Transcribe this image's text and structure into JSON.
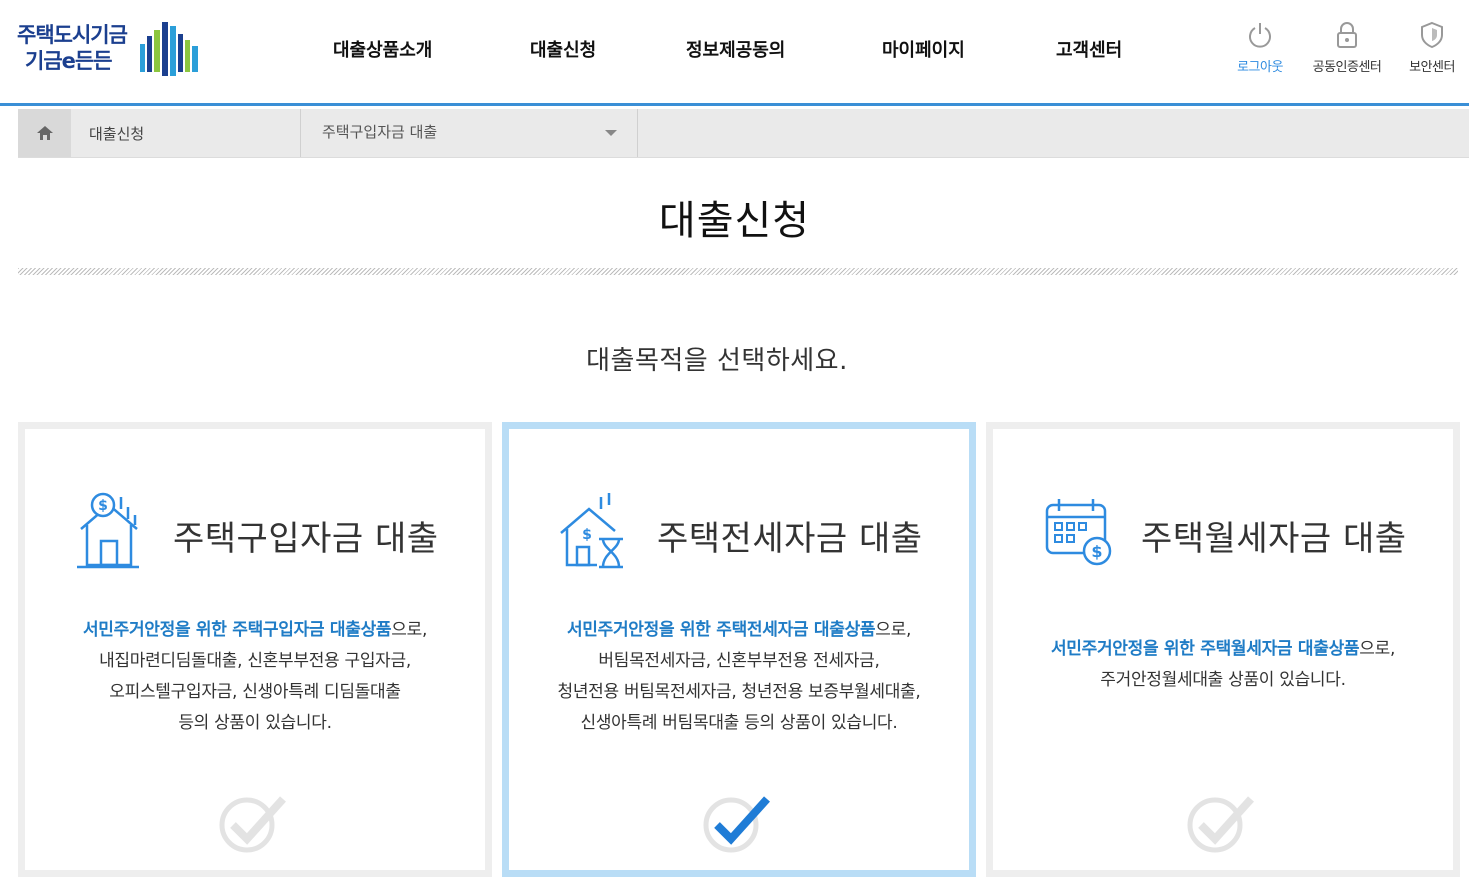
{
  "header": {
    "logo": {
      "line1": "주택도시기금",
      "line2": "기금e든든"
    },
    "nav": [
      {
        "label": "대출상품소개"
      },
      {
        "label": "대출신청"
      },
      {
        "label": "정보제공동의"
      },
      {
        "label": "마이페이지"
      },
      {
        "label": "고객센터"
      }
    ],
    "utils": [
      {
        "label": "로그아웃",
        "icon": "power-icon",
        "color": "#2e8be0"
      },
      {
        "label": "공동인증센터",
        "icon": "lock-icon"
      },
      {
        "label": "보안센터",
        "icon": "shield-icon"
      }
    ]
  },
  "breadcrumb": {
    "home_icon": "home-icon",
    "level1": "대출신청",
    "level2": "주택구입자금 대출"
  },
  "page": {
    "title": "대출신청",
    "subtitle": "대출목적을 선택하세요."
  },
  "cards": [
    {
      "name": "주택구입자금 대출",
      "icon": "house-dollar-icon",
      "selected": false,
      "desc_highlight": "서민주거안정을 위한 주택구입자금 대출상품",
      "desc_suffix": "으로,",
      "desc_lines": [
        "내집마련디딤돌대출, 신혼부부전용 구입자금,",
        "오피스텔구입자금, 신생아특례 디딤돌대출",
        "등의 상품이 있습니다."
      ]
    },
    {
      "name": "주택전세자금 대출",
      "icon": "house-hourglass-icon",
      "selected": true,
      "desc_highlight": "서민주거안정을 위한 주택전세자금 대출상품",
      "desc_suffix": "으로,",
      "desc_lines": [
        "버팀목전세자금, 신혼부부전용 전세자금,",
        "청년전용 버팀목전세자금, 청년전용 보증부월세대출,",
        "신생아특례 버팀목대출 등의 상품이 있습니다."
      ]
    },
    {
      "name": "주택월세자금 대출",
      "icon": "calendar-dollar-icon",
      "selected": false,
      "desc_highlight": "서민주거안정을 위한 주택월세자금 대출상품",
      "desc_suffix": "으로,",
      "desc_lines": [
        "주거안정월세대출 상품이 있습니다."
      ]
    }
  ],
  "colors": {
    "accent": "#2e8be0",
    "highlight_text": "#1f7cc6",
    "selected_border": "#b9ddf6",
    "check_active": "#1f7cd6",
    "check_inactive": "#e3e3e3"
  }
}
